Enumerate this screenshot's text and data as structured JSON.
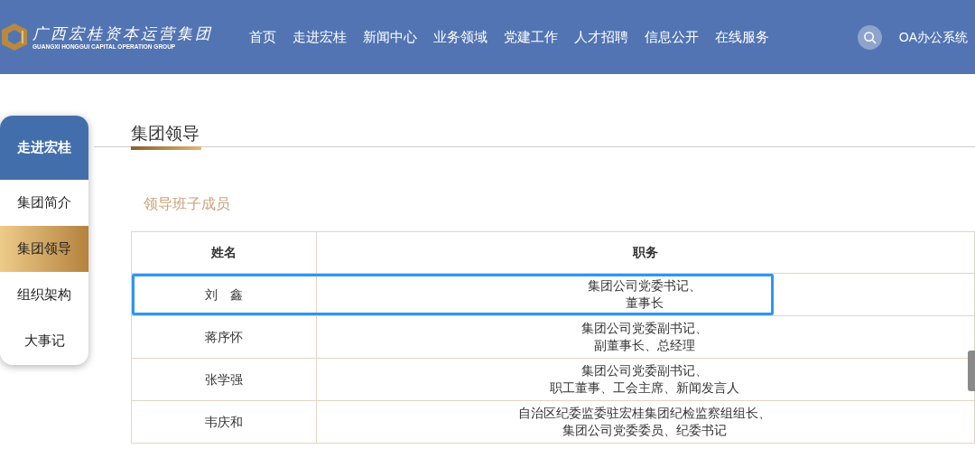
{
  "header": {
    "logo_text": "广西宏桂资本运营集团",
    "logo_subtext": "GUANGXI HONGGUI CAPITAL OPERATION GROUP",
    "nav": [
      {
        "label": "首页"
      },
      {
        "label": "走进宏桂"
      },
      {
        "label": "新闻中心"
      },
      {
        "label": "业务领域"
      },
      {
        "label": "党建工作"
      },
      {
        "label": "人才招聘"
      },
      {
        "label": "信息公开"
      },
      {
        "label": "在线服务"
      }
    ],
    "oa_link": "OA办公系统"
  },
  "sidebar": {
    "title": "走进宏桂",
    "items": [
      {
        "label": "集团简介",
        "selected": false
      },
      {
        "label": "集团领导",
        "selected": true
      },
      {
        "label": "组织架构",
        "selected": false
      },
      {
        "label": "大事记",
        "selected": false
      }
    ]
  },
  "page_title": "集团领导",
  "section_title": "领导班子成员",
  "table": {
    "columns": [
      "姓名",
      "职务"
    ],
    "rows": [
      {
        "name": "刘　鑫",
        "position": [
          "集团公司党委书记、",
          "董事长"
        ],
        "selected": true
      },
      {
        "name": "蒋序怀",
        "position": [
          "集团公司党委副书记、",
          "副董事长、总经理"
        ],
        "selected": false
      },
      {
        "name": "张学强",
        "position": [
          "集团公司党委副书记、",
          "职工董事、工会主席、新闻发言人"
        ],
        "selected": false
      },
      {
        "name": "韦庆和",
        "position": [
          "自治区纪委监委驻宏桂集团纪检监察组组长、",
          "集团公司党委委员、纪委书记"
        ],
        "selected": false
      }
    ]
  }
}
